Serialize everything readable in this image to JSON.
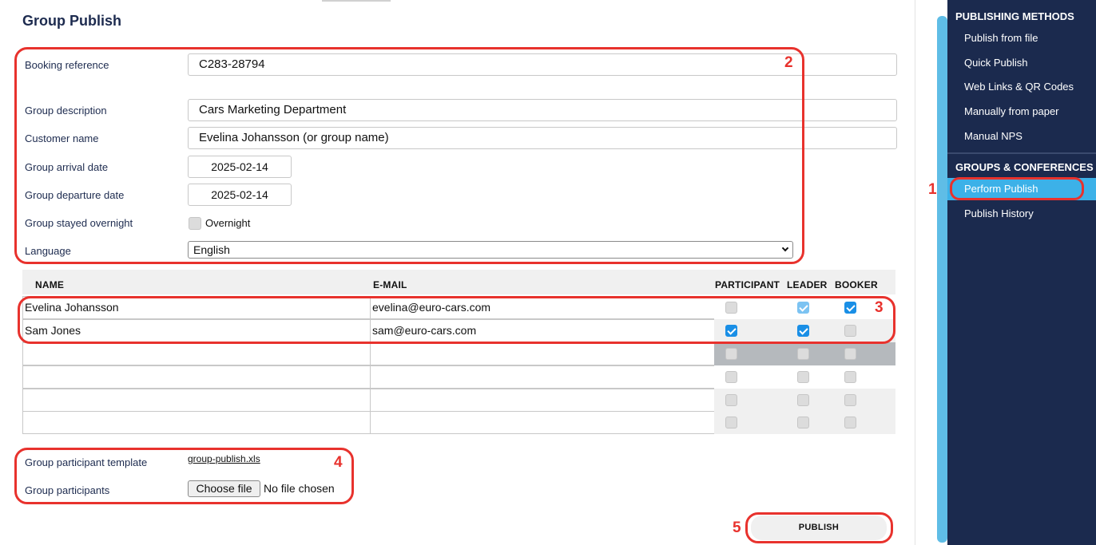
{
  "page": {
    "title": "Group Publish"
  },
  "form": {
    "booking_reference": {
      "label": "Booking reference",
      "value": "C283-28794"
    },
    "group_description": {
      "label": "Group description",
      "value": "Cars Marketing Department"
    },
    "customer_name": {
      "label": "Customer name",
      "value": "Evelina Johansson (or group name)"
    },
    "arrival_date": {
      "label": "Group arrival date",
      "value": "2025-02-14"
    },
    "departure_date": {
      "label": "Group departure date",
      "value": "2025-02-14"
    },
    "stayed_overnight": {
      "label": "Group stayed overnight",
      "checkbox_label": "Overnight",
      "checked": false
    },
    "language": {
      "label": "Language",
      "value": "English"
    }
  },
  "participants": {
    "columns": [
      "NAME",
      "E-MAIL",
      "PARTICIPANT",
      "LEADER",
      "BOOKER"
    ],
    "rows": [
      {
        "name": "Evelina Johansson",
        "email": "evelina@euro-cars.com",
        "participant": false,
        "leader": true,
        "booker": true
      },
      {
        "name": "Sam Jones",
        "email": "sam@euro-cars.com",
        "participant": true,
        "leader": true,
        "booker": false
      },
      {
        "name": "",
        "email": "",
        "participant": false,
        "leader": false,
        "booker": false
      },
      {
        "name": "",
        "email": "",
        "participant": false,
        "leader": false,
        "booker": false
      },
      {
        "name": "",
        "email": "",
        "participant": false,
        "leader": false,
        "booker": false
      },
      {
        "name": "",
        "email": "",
        "participant": false,
        "leader": false,
        "booker": false
      }
    ]
  },
  "upload": {
    "template_label": "Group participant template",
    "template_link": "group-publish.xls",
    "participants_label": "Group participants",
    "choose_file": "Choose file",
    "no_file": "No file chosen"
  },
  "publish_label": "PUBLISH",
  "annotations": [
    "1",
    "2",
    "3",
    "4",
    "5"
  ],
  "sidebar": {
    "sections": [
      {
        "title": "PUBLISHING METHODS",
        "items": [
          "Publish from file",
          "Quick Publish",
          "Web Links & QR Codes",
          "Manually from paper",
          "Manual NPS"
        ]
      },
      {
        "title": "GROUPS & CONFERENCES",
        "items": [
          "Perform Publish",
          "Publish History"
        ]
      }
    ],
    "active_item": "Perform Publish"
  },
  "colors": {
    "annotation": "#e8322d",
    "sidebar_bg": "#1b2a4e",
    "sidebar_active": "#3cb1e8",
    "checkbox_on": "#1a8fe6",
    "title": "#1d2b4f"
  }
}
